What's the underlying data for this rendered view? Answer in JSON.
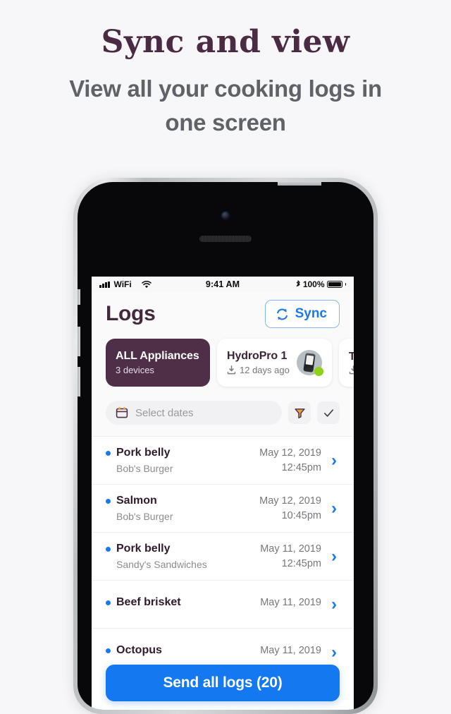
{
  "promo": {
    "title": "Sync and view",
    "subtitle": "View all your cooking logs in one screen"
  },
  "status_bar": {
    "carrier": "WiFi",
    "time": "9:41 AM",
    "battery_percent": "100%",
    "signal_icon": "signal-bars-icon",
    "wifi_icon": "wifi-icon",
    "bluetooth_icon": "bluetooth-icon",
    "battery_icon": "battery-full-icon"
  },
  "app": {
    "title": "Logs",
    "sync_button": {
      "label": "Sync",
      "icon": "refresh-circular-arrows-icon"
    },
    "devices": [
      {
        "name": "ALL Appliances",
        "meta": "3 devices",
        "active": true,
        "has_thumb": false,
        "has_download_icon": false
      },
      {
        "name": "HydroPro 1",
        "meta": "12 days ago",
        "active": false,
        "has_thumb": true,
        "has_download_icon": true,
        "status_color": "#8fd117"
      },
      {
        "name": "T",
        "meta": "",
        "active": false,
        "has_thumb": false,
        "has_download_icon": true,
        "cut_off": true
      }
    ],
    "filter": {
      "date_placeholder": "Select dates",
      "date_value": "",
      "calendar_icon": "calendar-icon",
      "funnel_icon": "filter-funnel-icon",
      "check_icon": "check-icon"
    },
    "logs": [
      {
        "title": "Pork belly",
        "location": "Bob's Burger",
        "date": "May 12, 2019",
        "time": "12:45pm"
      },
      {
        "title": "Salmon",
        "location": "Bob's Burger",
        "date": "May 12, 2019",
        "time": "10:45pm"
      },
      {
        "title": "Pork belly",
        "location": "Sandy's Sandwiches",
        "date": "May 11, 2019",
        "time": "12:45pm"
      },
      {
        "title": "Beef brisket",
        "location": "",
        "date": "May 11, 2019",
        "time": ""
      },
      {
        "title": "Octopus",
        "location": "",
        "date": "May 11, 2019",
        "time": ""
      }
    ],
    "cta": {
      "label": "Send all logs (20)"
    }
  },
  "colors": {
    "accent_blue": "#1478f0",
    "brand_purple": "#4e2f47",
    "status_green": "#8fd117",
    "page_background": "#f7f7f9",
    "filter_orange": "#e8a33d"
  }
}
